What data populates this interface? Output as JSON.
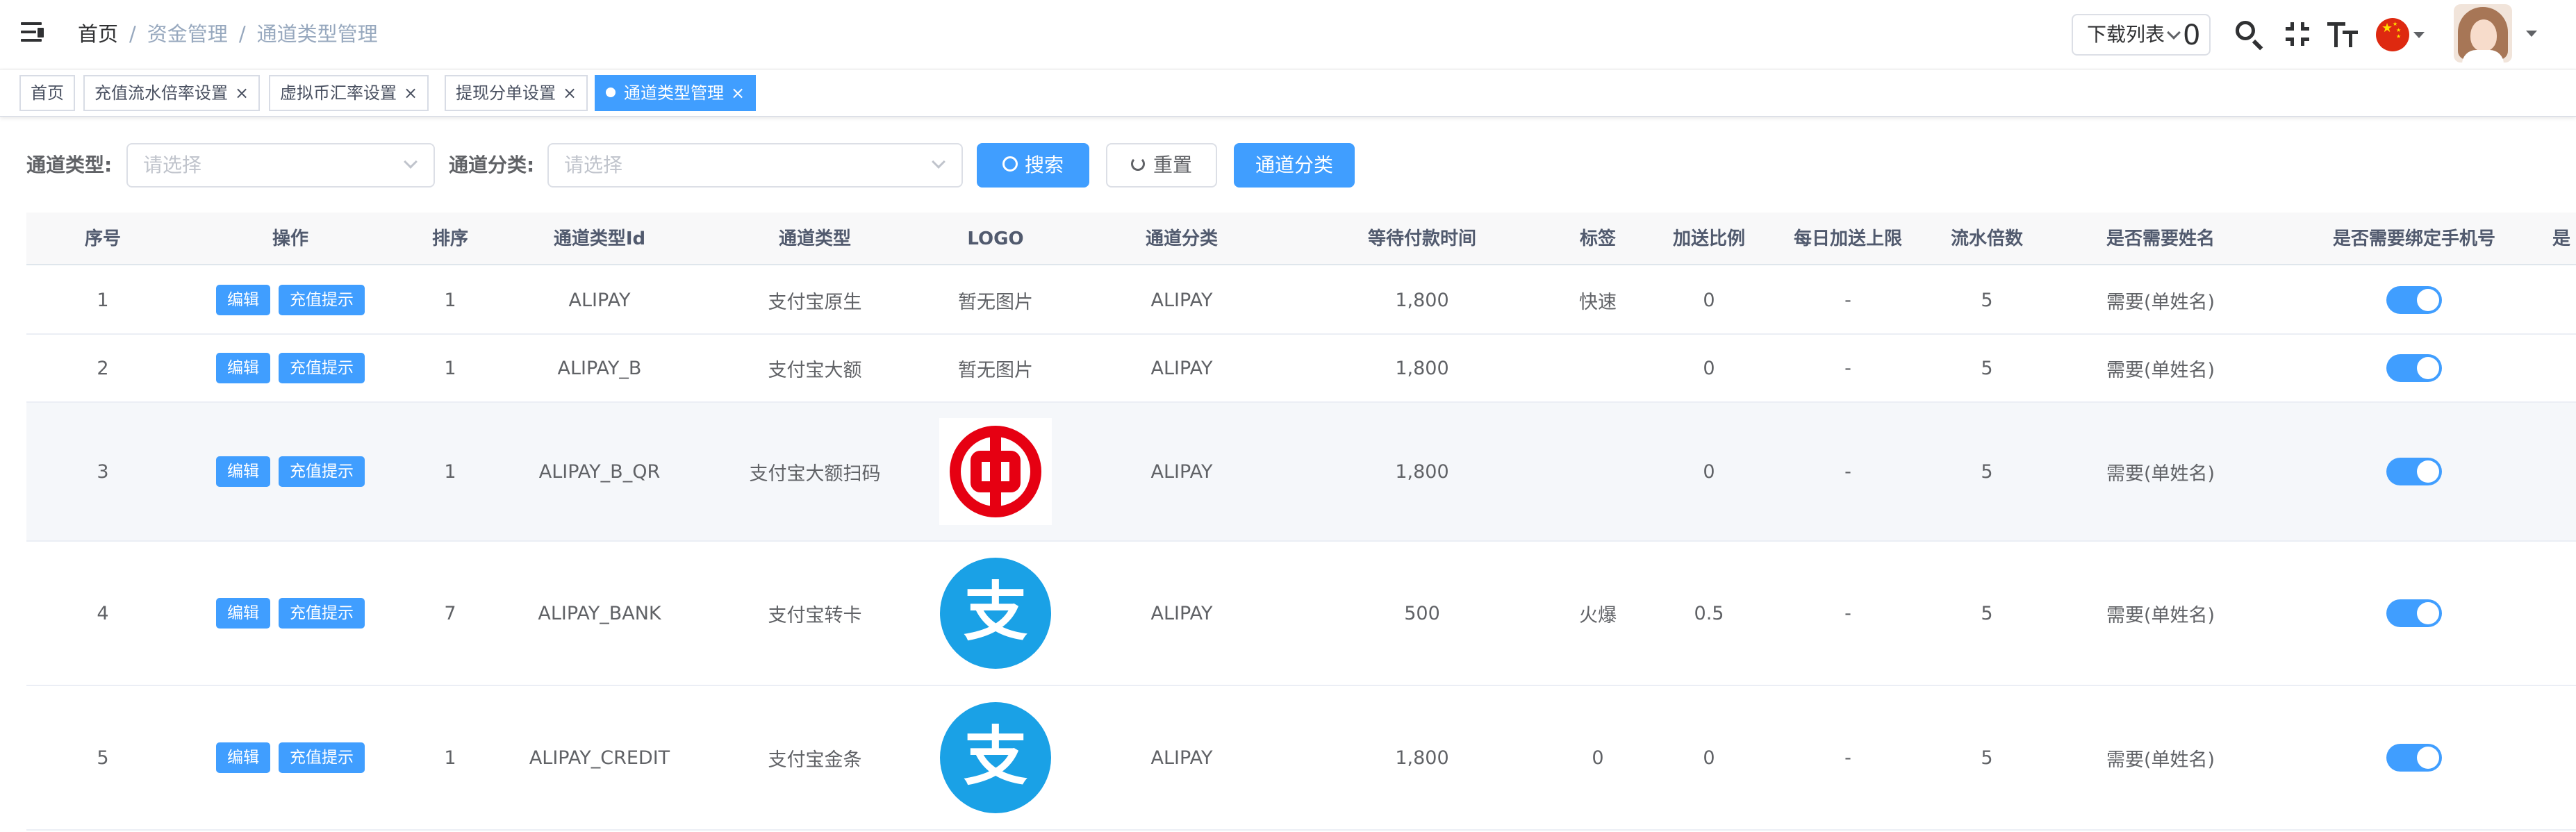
{
  "breadcrumb": {
    "home": "首页",
    "sep": "/",
    "level1": "资金管理",
    "current": "通道类型管理"
  },
  "header": {
    "download_label": "下载列表",
    "download_count": "0"
  },
  "tabs": [
    {
      "label": "首页",
      "closable": false,
      "active": false
    },
    {
      "label": "充值流水倍率设置",
      "closable": true,
      "active": false
    },
    {
      "label": "虚拟币汇率设置",
      "closable": true,
      "active": false
    },
    {
      "label": "提现分单设置",
      "closable": true,
      "active": false
    },
    {
      "label": "通道类型管理",
      "closable": true,
      "active": true
    }
  ],
  "tab_close_glyph": "×",
  "filters": {
    "type_label": "通道类型:",
    "type_placeholder": "请选择",
    "category_label": "通道分类:",
    "category_placeholder": "请选择",
    "search_label": "搜索",
    "reset_label": "重置",
    "category_btn_label": "通道分类"
  },
  "table": {
    "columns": [
      "序号",
      "操作",
      "排序",
      "通道类型Id",
      "通道类型",
      "LOGO",
      "通道分类",
      "等待付款时间",
      "标签",
      "加送比例",
      "每日加送上限",
      "流水倍数",
      "是否需要姓名",
      "是否需要绑定手机号",
      "是"
    ],
    "edit_label": "编辑",
    "tip_label": "充值提示",
    "rows": [
      {
        "index": "1",
        "sort": "1",
        "id": "ALIPAY",
        "type": "支付宝原生",
        "logo_text": "暂无图片",
        "logo_icon": "",
        "category": "ALIPAY",
        "wait": "1,800",
        "tag": "快速",
        "ratio": "0",
        "limit": "-",
        "multiple": "5",
        "name_req": "需要(单姓名)",
        "phone_bind": true
      },
      {
        "index": "2",
        "sort": "1",
        "id": "ALIPAY_B",
        "type": "支付宝大额",
        "logo_text": "暂无图片",
        "logo_icon": "",
        "category": "ALIPAY",
        "wait": "1,800",
        "tag": "",
        "ratio": "0",
        "limit": "-",
        "multiple": "5",
        "name_req": "需要(单姓名)",
        "phone_bind": true
      },
      {
        "index": "3",
        "sort": "1",
        "id": "ALIPAY_B_QR",
        "type": "支付宝大额扫码",
        "logo_text": "",
        "logo_icon": "bank-of-china-logo",
        "category": "ALIPAY",
        "wait": "1,800",
        "tag": "",
        "ratio": "0",
        "limit": "-",
        "multiple": "5",
        "name_req": "需要(单姓名)",
        "phone_bind": true
      },
      {
        "index": "4",
        "sort": "7",
        "id": "ALIPAY_BANK",
        "type": "支付宝转卡",
        "logo_text": "",
        "logo_icon": "alipay-logo",
        "category": "ALIPAY",
        "wait": "500",
        "tag": "火爆",
        "ratio": "0.5",
        "limit": "-",
        "multiple": "5",
        "name_req": "需要(单姓名)",
        "phone_bind": true
      },
      {
        "index": "5",
        "sort": "1",
        "id": "ALIPAY_CREDIT",
        "type": "支付宝金条",
        "logo_text": "",
        "logo_icon": "alipay-logo",
        "category": "ALIPAY",
        "wait": "1,800",
        "tag": "0",
        "ratio": "0",
        "limit": "-",
        "multiple": "5",
        "name_req": "需要(单姓名)",
        "phone_bind": true
      }
    ],
    "alipay_glyph": "支"
  },
  "colors": {
    "primary": "#409eff",
    "alipay": "#1aa1e6",
    "boc_red": "#e60012"
  }
}
